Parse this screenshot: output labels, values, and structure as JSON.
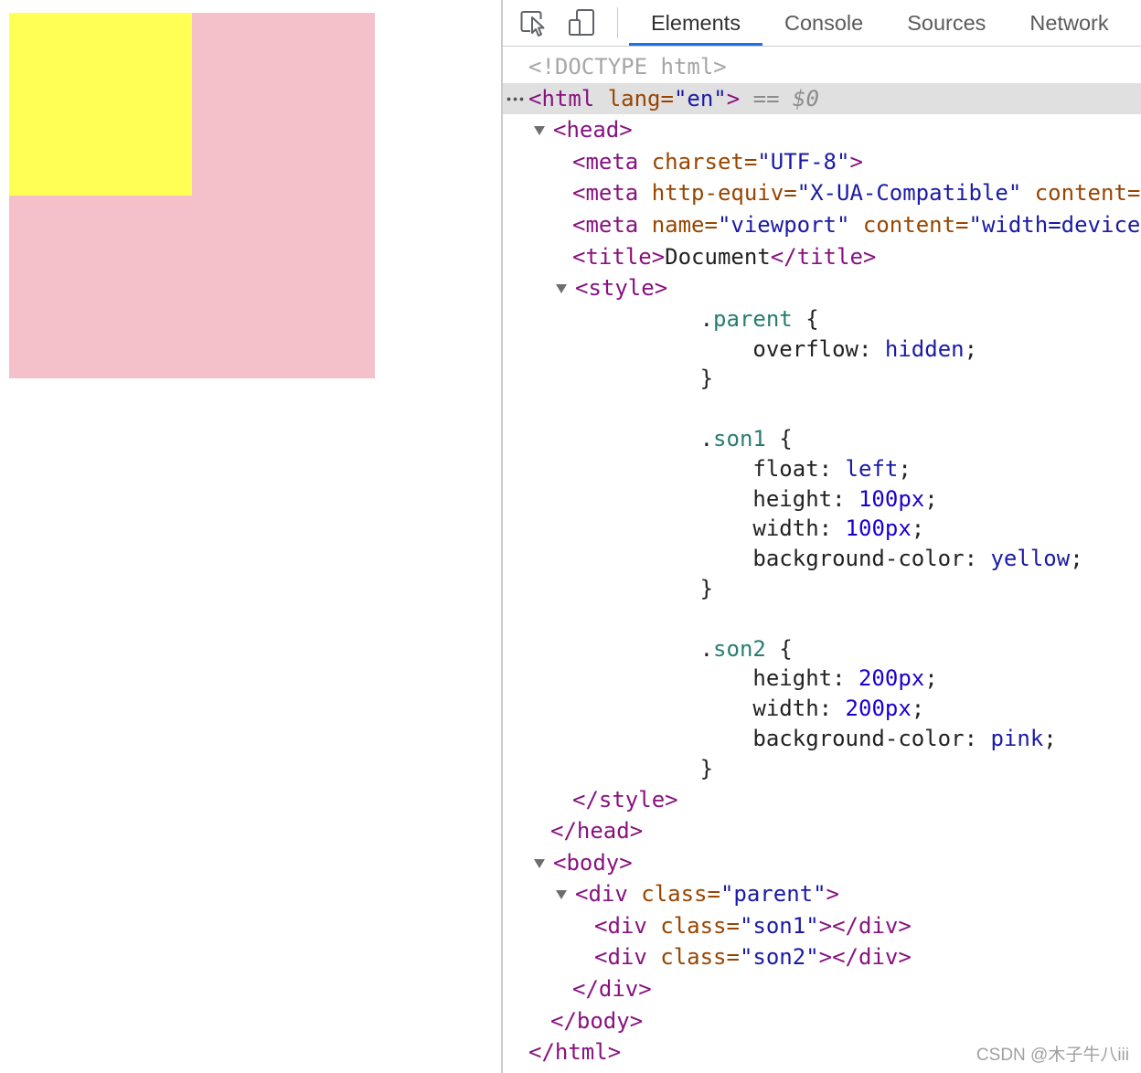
{
  "page_preview": {
    "son1_color": "#ffff54",
    "son2_color": "#f4c1cb"
  },
  "devtools": {
    "toolbar": {
      "inspect_icon": "inspect-element-icon",
      "device_icon": "device-toolbar-icon",
      "tabs": [
        {
          "label": "Elements",
          "active": true
        },
        {
          "label": "Console",
          "active": false
        },
        {
          "label": "Sources",
          "active": false
        },
        {
          "label": "Network",
          "active": false
        }
      ]
    },
    "colors": {
      "accent": "#1a73e8",
      "tag": "#881280",
      "attr": "#994500",
      "val": "#1a1aa6",
      "text": "#222222",
      "doctype": "#a6a6a6",
      "marker": "#8c8c8c",
      "css_selector": "#267d72",
      "css_keyword": "#1a1aa6",
      "css_number": "#1c00cf",
      "selected_row": "#e0e0e0"
    },
    "dom_tree": [
      {
        "open": [
          {
            "c": "doctype",
            "v": "<!DOCTYPE html>"
          }
        ]
      },
      {
        "selected": true,
        "expanded": true,
        "gutter_icon": "more-actions-icon",
        "open": [
          {
            "c": "tag",
            "v": "<html"
          },
          {
            "c": "attr",
            "v": " lang="
          },
          {
            "c": "val",
            "v": "\"en\""
          },
          {
            "c": "tag",
            "v": ">"
          },
          {
            "c": "marker",
            "v": " == "
          },
          {
            "c": "marker-var",
            "v": "$0"
          }
        ],
        "children": [
          {
            "expanded": true,
            "open": [
              {
                "c": "tag",
                "v": "<head>"
              }
            ],
            "children": [
              {
                "open": [
                  {
                    "c": "tag",
                    "v": "<meta"
                  },
                  {
                    "c": "attr",
                    "v": " charset="
                  },
                  {
                    "c": "val",
                    "v": "\"UTF-8\""
                  },
                  {
                    "c": "tag",
                    "v": ">"
                  }
                ]
              },
              {
                "open": [
                  {
                    "c": "tag",
                    "v": "<meta"
                  },
                  {
                    "c": "attr",
                    "v": " http-equiv="
                  },
                  {
                    "c": "val",
                    "v": "\"X-UA-Compatible\""
                  },
                  {
                    "c": "attr",
                    "v": " content="
                  }
                ]
              },
              {
                "open": [
                  {
                    "c": "tag",
                    "v": "<meta"
                  },
                  {
                    "c": "attr",
                    "v": " name="
                  },
                  {
                    "c": "val",
                    "v": "\"viewport\""
                  },
                  {
                    "c": "attr",
                    "v": " content="
                  },
                  {
                    "c": "val",
                    "v": "\"width=device"
                  }
                ]
              },
              {
                "open": [
                  {
                    "c": "tag",
                    "v": "<title>"
                  },
                  {
                    "c": "text",
                    "v": "Document"
                  },
                  {
                    "c": "tag",
                    "v": "</title>"
                  }
                ]
              },
              {
                "expanded": true,
                "open": [
                  {
                    "c": "tag",
                    "v": "<style>"
                  }
                ],
                "css": [
                  [
                    {
                      "c": "plain",
                      "v": "."
                    },
                    {
                      "c": "sel",
                      "v": "parent"
                    },
                    {
                      "c": "plain",
                      "v": " {"
                    }
                  ],
                  [
                    {
                      "c": "plain",
                      "v": "overflow: "
                    },
                    {
                      "c": "kw",
                      "v": "hidden"
                    },
                    {
                      "c": "plain",
                      "v": ";"
                    }
                  ],
                  [
                    {
                      "c": "plain",
                      "v": "}"
                    }
                  ],
                  [],
                  [
                    {
                      "c": "plain",
                      "v": "."
                    },
                    {
                      "c": "sel",
                      "v": "son1"
                    },
                    {
                      "c": "plain",
                      "v": " {"
                    }
                  ],
                  [
                    {
                      "c": "plain",
                      "v": "float: "
                    },
                    {
                      "c": "kw",
                      "v": "left"
                    },
                    {
                      "c": "plain",
                      "v": ";"
                    }
                  ],
                  [
                    {
                      "c": "plain",
                      "v": "height: "
                    },
                    {
                      "c": "num",
                      "v": "100px"
                    },
                    {
                      "c": "plain",
                      "v": ";"
                    }
                  ],
                  [
                    {
                      "c": "plain",
                      "v": "width: "
                    },
                    {
                      "c": "num",
                      "v": "100px"
                    },
                    {
                      "c": "plain",
                      "v": ";"
                    }
                  ],
                  [
                    {
                      "c": "plain",
                      "v": "background-color: "
                    },
                    {
                      "c": "kw",
                      "v": "yellow"
                    },
                    {
                      "c": "plain",
                      "v": ";"
                    }
                  ],
                  [
                    {
                      "c": "plain",
                      "v": "}"
                    }
                  ],
                  [],
                  [
                    {
                      "c": "plain",
                      "v": "."
                    },
                    {
                      "c": "sel",
                      "v": "son2"
                    },
                    {
                      "c": "plain",
                      "v": " {"
                    }
                  ],
                  [
                    {
                      "c": "plain",
                      "v": "height: "
                    },
                    {
                      "c": "num",
                      "v": "200px"
                    },
                    {
                      "c": "plain",
                      "v": ";"
                    }
                  ],
                  [
                    {
                      "c": "plain",
                      "v": "width: "
                    },
                    {
                      "c": "num",
                      "v": "200px"
                    },
                    {
                      "c": "plain",
                      "v": ";"
                    }
                  ],
                  [
                    {
                      "c": "plain",
                      "v": "background-color: "
                    },
                    {
                      "c": "kw",
                      "v": "pink"
                    },
                    {
                      "c": "plain",
                      "v": ";"
                    }
                  ],
                  [
                    {
                      "c": "plain",
                      "v": "}"
                    }
                  ]
                ],
                "close": [
                  {
                    "c": "tag",
                    "v": "</style>"
                  }
                ]
              }
            ],
            "close": [
              {
                "c": "tag",
                "v": "</head>"
              }
            ]
          },
          {
            "expanded": true,
            "open": [
              {
                "c": "tag",
                "v": "<body>"
              }
            ],
            "children": [
              {
                "expanded": true,
                "open": [
                  {
                    "c": "tag",
                    "v": "<div"
                  },
                  {
                    "c": "attr",
                    "v": " class="
                  },
                  {
                    "c": "val",
                    "v": "\"parent\""
                  },
                  {
                    "c": "tag",
                    "v": ">"
                  }
                ],
                "children": [
                  {
                    "open": [
                      {
                        "c": "tag",
                        "v": "<div"
                      },
                      {
                        "c": "attr",
                        "v": " class="
                      },
                      {
                        "c": "val",
                        "v": "\"son1\""
                      },
                      {
                        "c": "tag",
                        "v": "></div>"
                      }
                    ]
                  },
                  {
                    "open": [
                      {
                        "c": "tag",
                        "v": "<div"
                      },
                      {
                        "c": "attr",
                        "v": " class="
                      },
                      {
                        "c": "val",
                        "v": "\"son2\""
                      },
                      {
                        "c": "tag",
                        "v": "></div>"
                      }
                    ]
                  }
                ],
                "close": [
                  {
                    "c": "tag",
                    "v": "</div>"
                  }
                ]
              }
            ],
            "close": [
              {
                "c": "tag",
                "v": "</body>"
              }
            ]
          }
        ],
        "close": [
          {
            "c": "tag",
            "v": "</html>"
          }
        ]
      }
    ]
  },
  "watermark": "CSDN @木子牛八iii"
}
